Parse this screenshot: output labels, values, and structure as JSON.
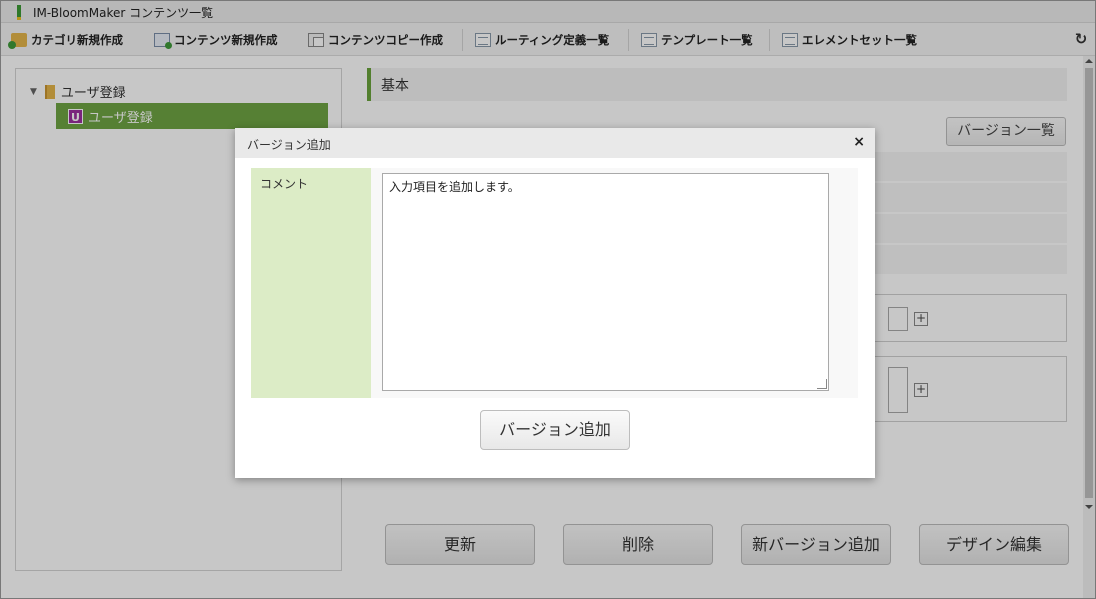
{
  "window": {
    "title": "IM-BloomMaker コンテンツ一覧"
  },
  "toolbar": {
    "items": [
      {
        "label": "カテゴリ新規作成",
        "icon": "folder-add-icon"
      },
      {
        "label": "コンテンツ新規作成",
        "icon": "content-add-icon"
      },
      {
        "label": "コンテンツコピー作成",
        "icon": "copy-icon"
      },
      {
        "label": "ルーティング定義一覧",
        "icon": "list-icon"
      },
      {
        "label": "テンプレート一覧",
        "icon": "list-icon"
      },
      {
        "label": "エレメントセット一覧",
        "icon": "list-icon"
      }
    ],
    "refresh_icon": "refresh-icon"
  },
  "tree": {
    "root_label": "ユーザ登録",
    "child_badge": "U",
    "child_label": "ユーザ登録"
  },
  "main": {
    "section_title": "基本",
    "version_list_label": "バージョン一覧",
    "buttons": {
      "update": "更新",
      "delete": "削除",
      "new_version": "新バージョン追加",
      "design_edit": "デザイン編集"
    }
  },
  "dialog": {
    "title": "バージョン追加",
    "comment_label": "コメント",
    "comment_value": "入力項目を追加します。",
    "submit_label": "バージョン追加",
    "close_symbol": "×"
  },
  "colors": {
    "accent_green": "#6fa543",
    "label_bg": "#dcecc6",
    "badge_purple": "#9b2f9f"
  }
}
